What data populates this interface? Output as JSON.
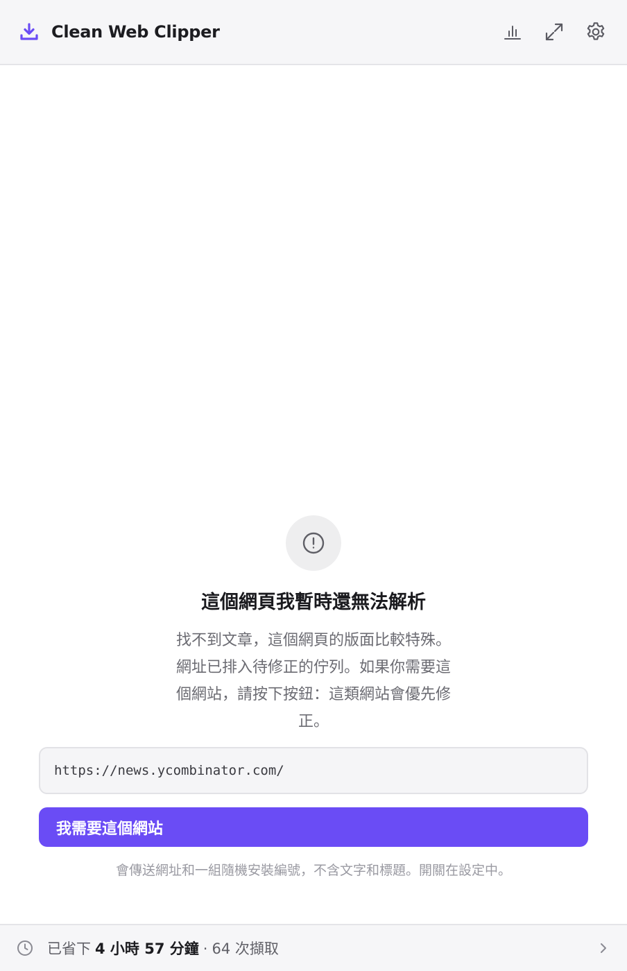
{
  "header": {
    "title": "Clean Web Clipper",
    "brand_icon": "download-icon",
    "accent_color": "#6a4cf5",
    "actions": [
      {
        "icon": "bar-chart-icon"
      },
      {
        "icon": "expand-icon"
      },
      {
        "icon": "gear-icon"
      }
    ]
  },
  "error": {
    "icon": "alert-circle-icon",
    "title": "這個網頁我暫時還無法解析",
    "description_lines": [
      "找不到文章，這個網頁的版面比較特殊。",
      "網址已排入待修正的佇列。如果你需要這",
      "個網站，請按下按鈕：這類網站會優先修",
      "正。"
    ]
  },
  "url_field": {
    "value": "https://news.ycombinator.com/"
  },
  "request_button": {
    "label": "我需要這個網站"
  },
  "privacy_note": "會傳送網址和一組隨機安裝編號，不含文字和標題。開關在設定中。",
  "footer": {
    "icon": "clock-icon",
    "prefix": "已省下",
    "time_saved": "4 小時 57 分鐘",
    "separator": "·",
    "count_text": "64 次擷取",
    "chevron": "chevron-right-icon"
  }
}
